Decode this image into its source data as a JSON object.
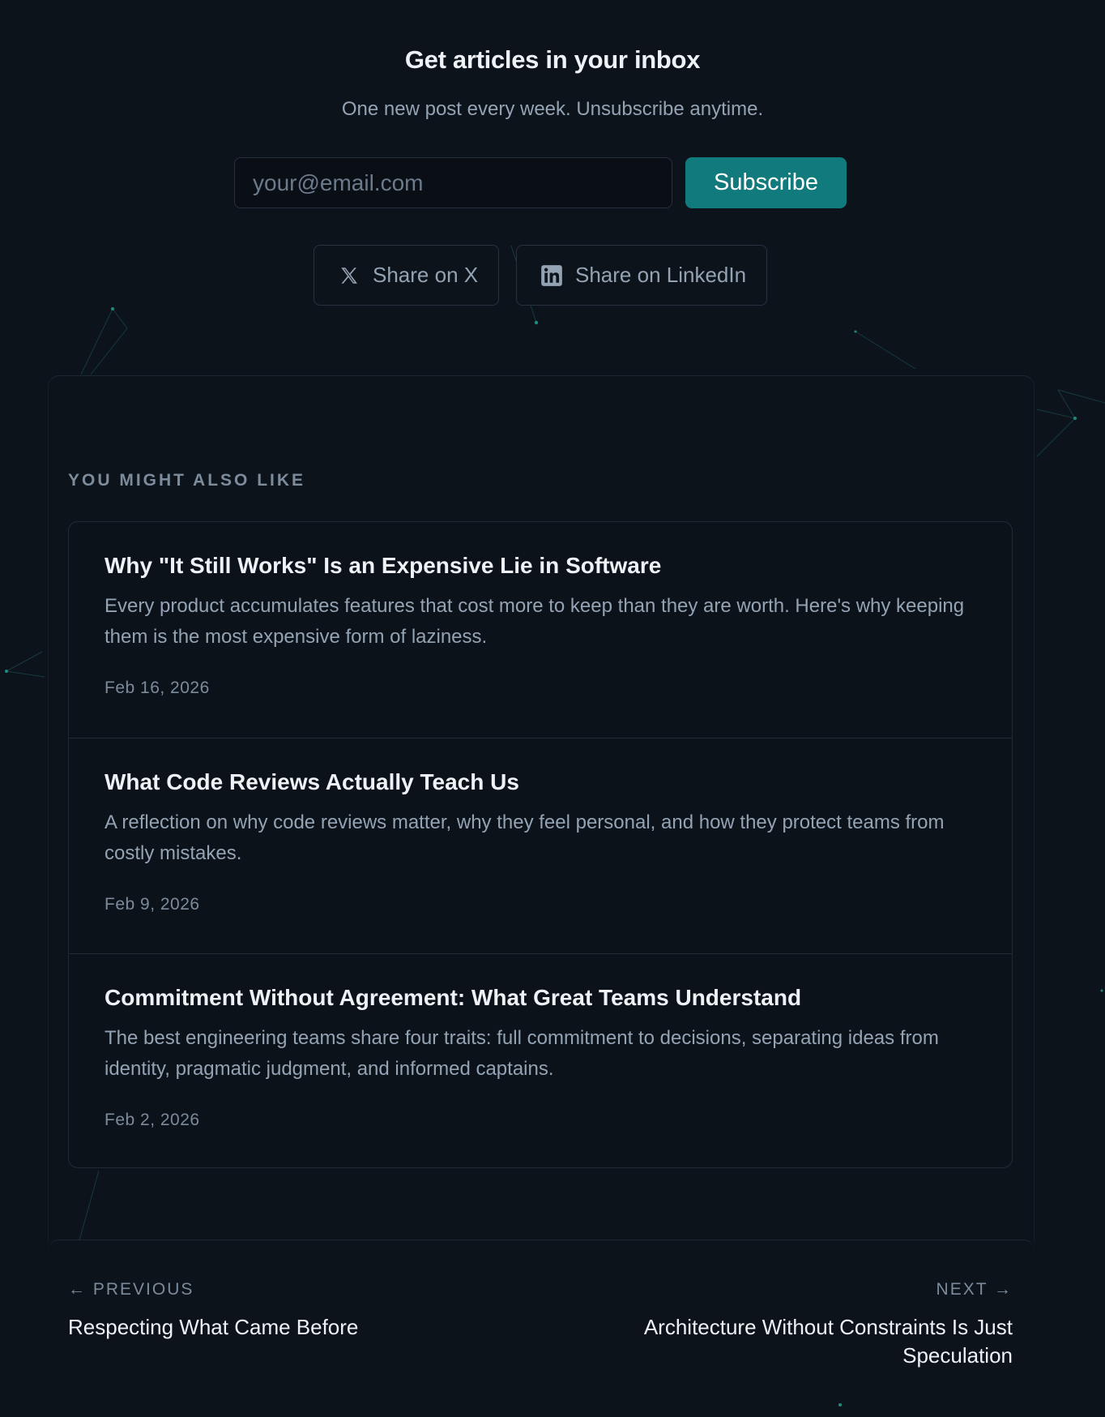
{
  "colors": {
    "background": "#0d131b",
    "accent": "#117a7c",
    "text_primary": "#eef2f6",
    "text_secondary": "#94a3b4",
    "text_muted": "#7c8b9b",
    "border": "#212b37"
  },
  "newsletter": {
    "title": "Get articles in your inbox",
    "subtitle": "One new post every week. Unsubscribe anytime.",
    "email_placeholder": "your@email.com",
    "email_value": "",
    "subscribe_label": "Subscribe"
  },
  "share": {
    "x_label": "Share on X",
    "x_icon": "x-logo-icon",
    "linkedin_label": "Share on LinkedIn",
    "linkedin_icon": "linkedin-icon"
  },
  "related": {
    "heading": "YOU MIGHT ALSO LIKE",
    "items": [
      {
        "title": "Why \"It Still Works\" Is an Expensive Lie in Software",
        "description": "Every product accumulates features that cost more to keep than they are worth. Here's why keeping them is the most expensive form of laziness.",
        "date": "Feb 16, 2026"
      },
      {
        "title": "What Code Reviews Actually Teach Us",
        "description": "A reflection on why code reviews matter, why they feel personal, and how they protect teams from costly mistakes.",
        "date": "Feb 9, 2026"
      },
      {
        "title": "Commitment Without Agreement: What Great Teams Understand",
        "description": "The best engineering teams share four traits: full commitment to decisions, separating ideas from identity, pragmatic judgment, and informed captains.",
        "date": "Feb 2, 2026"
      }
    ]
  },
  "post_nav": {
    "previous_label": "← PREVIOUS",
    "previous_title": "Respecting What Came Before",
    "next_label": "NEXT →",
    "next_title": "Architecture Without Constraints Is Just Speculation"
  }
}
